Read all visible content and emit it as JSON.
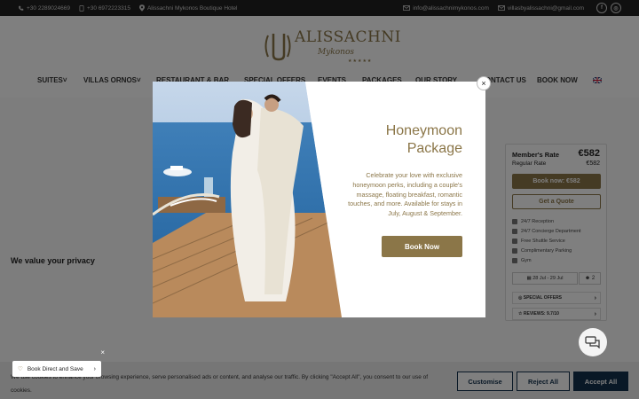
{
  "topbar": {
    "phone1": "+30 2289024669",
    "phone2": "+30 6972223315",
    "address": "Alissachni Mykonos Boutique Hotel",
    "email1": "info@alissachnimykonos.com",
    "email2": "villasbyalissachni@gmail.com",
    "social": [
      {
        "icon": "facebook-icon",
        "glyph": "f"
      },
      {
        "icon": "instagram-icon",
        "glyph": "◎"
      }
    ]
  },
  "logo": {
    "text": "ALISSACHNI",
    "sub": "Mykonos",
    "stars": "★★★★★"
  },
  "nav": {
    "items": [
      "SUITES",
      "VILLAS ORNOS",
      "RESTAURANT & BAR",
      "SPECIAL OFFERS",
      "EVENTS",
      "PACKAGES",
      "OUR STORY",
      "CONTACT US",
      "BOOK NOW"
    ],
    "flag_icon": "uk-flag-icon"
  },
  "panel": {
    "member_label": "Member's Rate",
    "member_price": "€582",
    "regular_label": "Regular Rate",
    "regular_price": "€582",
    "book_label": "Book now: €582",
    "quote_label": "Get a Quote",
    "features": [
      "24/7 Reception",
      "24/7 Concierge Department",
      "Free Shuttle Service",
      "Complimentary Parking",
      "Gym"
    ],
    "dates": "28 Jul - 29 Jul",
    "guests": "2",
    "special_offers": "SPECIAL OFFERS",
    "reviews": "REVIEWS: 9.7/10"
  },
  "privacy": {
    "heading": "We value your privacy",
    "text": "We use cookies to enhance your browsing experience, serve personalised ads or content, and analyse our traffic. By clicking \"Accept All\", you consent to our use of cookies.",
    "customise": "Customise",
    "reject": "Reject All",
    "accept": "Accept All"
  },
  "bookdirect": {
    "label": "Book Direct and Save",
    "close": "×",
    "chevron": "›"
  },
  "modal": {
    "title": "Honeymoon Package",
    "description": "Celebrate your love with exclusive honeymoon perks, including a couple's massage, floating breakfast, romantic touches, and more. Available for stays in July, August & September.",
    "button": "Book Now",
    "close": "×"
  },
  "colors": {
    "accent": "#8b7648",
    "navy": "#12314d",
    "topbar": "#212121"
  }
}
